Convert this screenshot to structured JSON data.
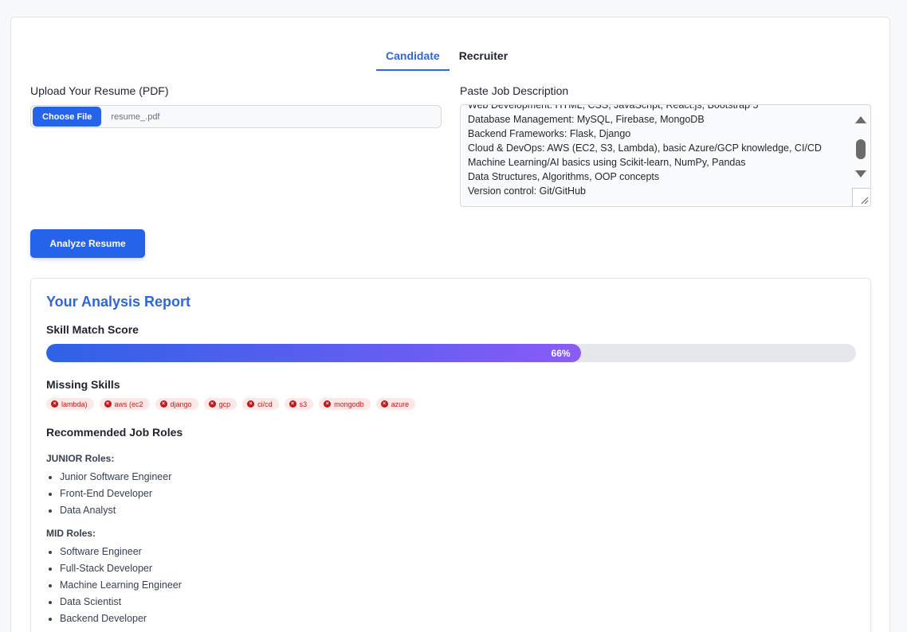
{
  "tabs": [
    {
      "label": "Candidate",
      "active": true
    },
    {
      "label": "Recruiter",
      "active": false
    }
  ],
  "upload": {
    "label": "Upload Your Resume (PDF)",
    "button_label": "Choose File",
    "file_name": "resume_.pdf"
  },
  "job_description": {
    "label": "Paste Job Description",
    "lines": [
      "Web Development: HTML, CSS, JavaScript, React.js, Bootstrap 5",
      "Database Management: MySQL, Firebase, MongoDB",
      "Backend Frameworks: Flask, Django",
      "Cloud & DevOps: AWS (EC2, S3, Lambda), basic Azure/GCP knowledge, CI/CD",
      "Machine Learning/AI basics using Scikit-learn, NumPy, Pandas",
      "Data Structures, Algorithms, OOP concepts",
      "Version control: Git/GitHub"
    ]
  },
  "analyze_button": "Analyze Resume",
  "report": {
    "title": "Your Analysis Report",
    "score_heading": "Skill Match Score",
    "score_percent": 66,
    "score_label": "66%",
    "missing_heading": "Missing Skills",
    "missing_skills": [
      "lambda)",
      "aws (ec2",
      "django",
      "gcp",
      "ci/cd",
      "s3",
      "mongodb",
      "azure"
    ],
    "roles_heading": "Recommended Job Roles",
    "role_groups": [
      {
        "title": "JUNIOR Roles:",
        "roles": [
          "Junior Software Engineer",
          "Front-End Developer",
          "Data Analyst"
        ]
      },
      {
        "title": "MID Roles:",
        "roles": [
          "Software Engineer",
          "Full-Stack Developer",
          "Machine Learning Engineer",
          "Data Scientist",
          "Backend Developer"
        ]
      }
    ]
  },
  "colors": {
    "accent": "#2563eb",
    "title_blue": "#2f66d8",
    "chip_bg": "#fde8e8",
    "chip_text": "#b91c1c"
  }
}
